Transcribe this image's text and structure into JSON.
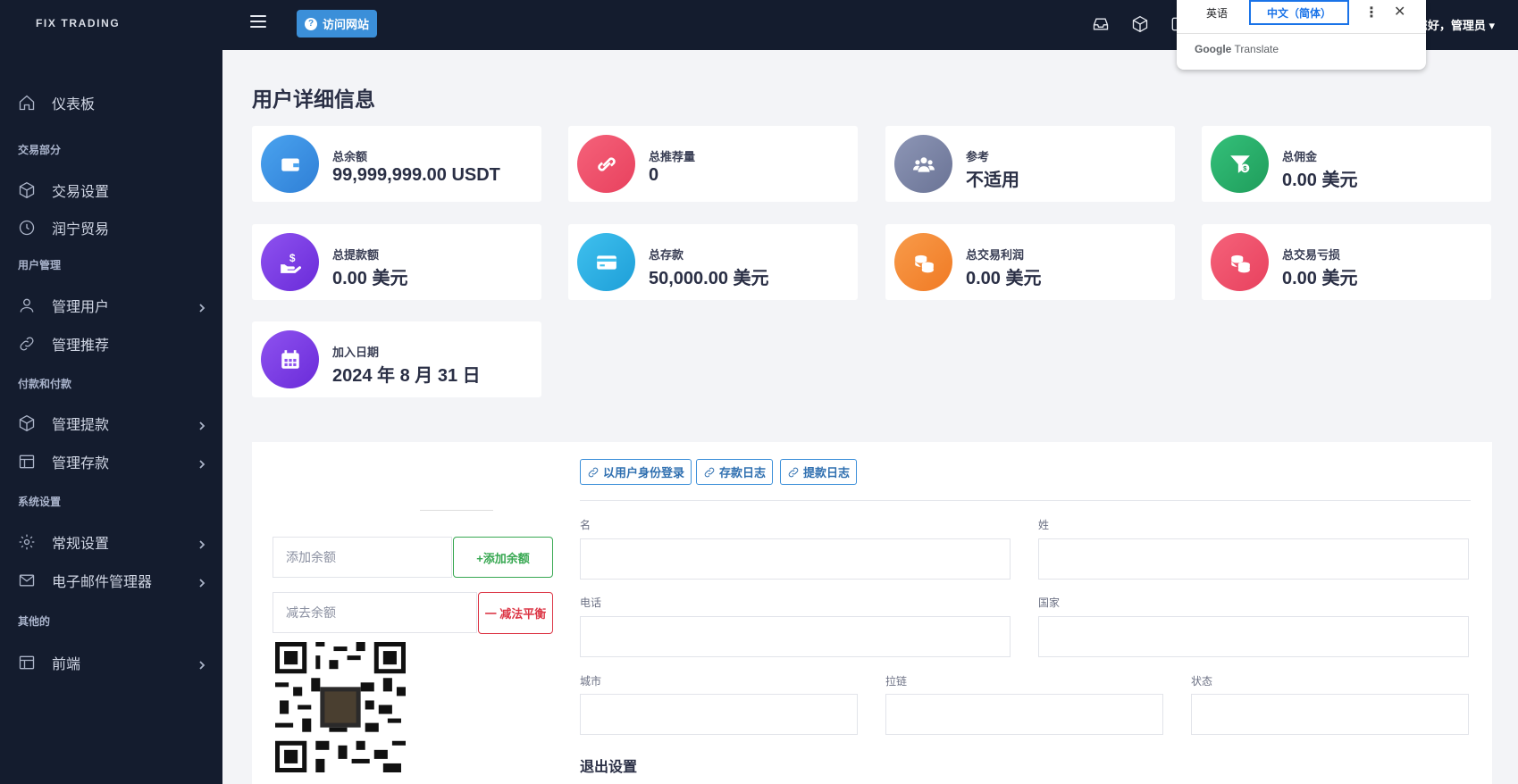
{
  "brand": "FIX TRADING",
  "sidebar": {
    "items": [
      {
        "type": "item",
        "label": "仪表板",
        "icon": "home-icon",
        "chevron": false
      },
      {
        "type": "group",
        "label": "交易部分"
      },
      {
        "type": "item",
        "label": "交易设置",
        "icon": "cube-icon",
        "chevron": false
      },
      {
        "type": "item",
        "label": "润宁贸易",
        "icon": "clock-icon",
        "chevron": false
      },
      {
        "type": "group",
        "label": "用户管理"
      },
      {
        "type": "item",
        "label": "管理用户",
        "icon": "user-icon",
        "chevron": true
      },
      {
        "type": "item",
        "label": "管理推荐",
        "icon": "link-icon",
        "chevron": false
      },
      {
        "type": "group",
        "label": "付款和付款"
      },
      {
        "type": "item",
        "label": "管理提款",
        "icon": "cube-icon",
        "chevron": true
      },
      {
        "type": "item",
        "label": "管理存款",
        "icon": "table-icon",
        "chevron": true
      },
      {
        "type": "group",
        "label": "系统设置"
      },
      {
        "type": "item",
        "label": "常规设置",
        "icon": "gear-icon",
        "chevron": true
      },
      {
        "type": "item",
        "label": "电子邮件管理器",
        "icon": "mail-icon",
        "chevron": true
      },
      {
        "type": "group",
        "label": "其他的"
      },
      {
        "type": "item",
        "label": "前端",
        "icon": "layout-icon",
        "chevron": true
      }
    ]
  },
  "topbar": {
    "visit_label": "访问网站",
    "greeting": "您好，管理员 ▾"
  },
  "translate": {
    "lang_source": "英语",
    "lang_target": "中文（简体）",
    "more": "⋮",
    "close": "✕",
    "brand_google": "Google",
    "brand_translate": "Translate"
  },
  "page_title": "用户详细信息",
  "cards": [
    {
      "label": "总余额",
      "value": "99,999,999.00 USDT",
      "color": "#2f7fd6",
      "color2": "#4aa3ef",
      "icon": "wallet-icon"
    },
    {
      "label": "总推荐量",
      "value": "0",
      "color": "#e8415e",
      "color2": "#f5627a",
      "icon": "link-icon"
    },
    {
      "label": "参考",
      "value": "不适用",
      "color": "#6a7395",
      "color2": "#8d96b6",
      "icon": "users-icon"
    },
    {
      "label": "总佣金",
      "value": "0.00 美元",
      "color": "#1f9d5b",
      "color2": "#34c07a",
      "icon": "funnel-dollar-icon"
    },
    {
      "label": "总提款额",
      "value": "0.00 美元",
      "color": "#6a2bd9",
      "color2": "#8e52ef",
      "icon": "hand-dollar-icon"
    },
    {
      "label": "总存款",
      "value": "50,000.00 美元",
      "color": "#1e9fd8",
      "color2": "#3fc0ee",
      "icon": "card-icon"
    },
    {
      "label": "总交易利润",
      "value": "0.00 美元",
      "color": "#f07a24",
      "color2": "#f89b4a",
      "icon": "coins-icon"
    },
    {
      "label": "总交易亏损",
      "value": "0.00 美元",
      "color": "#e8415e",
      "color2": "#f5627a",
      "icon": "coins-icon"
    },
    {
      "label": "加入日期",
      "value": "2024 年 8 月 31 日",
      "color": "#6a2bd9",
      "color2": "#8e52ef",
      "icon": "calendar-icon"
    }
  ],
  "balance": {
    "add_placeholder": "添加余额",
    "add_button": "+添加余额",
    "sub_placeholder": "减去余额",
    "sub_button": "一 减法平衡"
  },
  "actions": {
    "login_as_user": "以用户身份登录",
    "deposit_log": "存款日志",
    "withdraw_log": "提款日志"
  },
  "form": {
    "first_name": "名",
    "last_name": "姓",
    "phone": "电话",
    "country": "国家",
    "city": "城市",
    "zip": "拉链",
    "state": "状态",
    "logout_settings": "退出设置"
  }
}
